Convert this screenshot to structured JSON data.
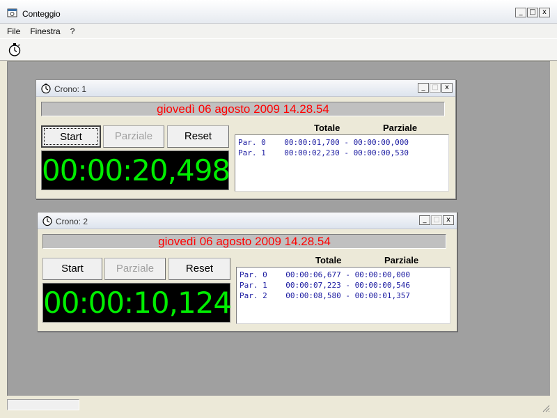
{
  "app": {
    "title": "Conteggio",
    "menu": [
      "File",
      "Finestra",
      "?"
    ],
    "window_buttons": [
      "_",
      "□",
      "x"
    ]
  },
  "colors": {
    "date_text": "#ff0000",
    "display_text": "#00ee00",
    "list_text": "#1a1aa0"
  },
  "icons": {
    "app": "stopwatch-window-icon",
    "toolbar": "stopwatch-icon",
    "crono": "stopwatch-icon"
  },
  "cronos": [
    {
      "title": "Crono: 1",
      "date": "giovedì 06 agosto 2009  14.28.54",
      "buttons": {
        "start": "Start",
        "parziale": "Parziale",
        "reset": "Reset"
      },
      "display": "00:00:20,498",
      "headers": {
        "totale": "Totale",
        "parziale": "Parziale"
      },
      "rows": [
        "Par. 0    00:00:01,700 - 00:00:00,000",
        "Par. 1    00:00:02,230 - 00:00:00,530"
      ]
    },
    {
      "title": "Crono: 2",
      "date": "giovedì 06 agosto 2009  14.28.54",
      "buttons": {
        "start": "Start",
        "parziale": "Parziale",
        "reset": "Reset"
      },
      "display": "00:00:10,124",
      "headers": {
        "totale": "Totale",
        "parziale": "Parziale"
      },
      "rows": [
        "Par. 0    00:00:06,677 - 00:00:00,000",
        "Par. 1    00:00:07,223 - 00:00:00,546",
        "Par. 2    00:00:08,580 - 00:00:01,357"
      ]
    }
  ]
}
